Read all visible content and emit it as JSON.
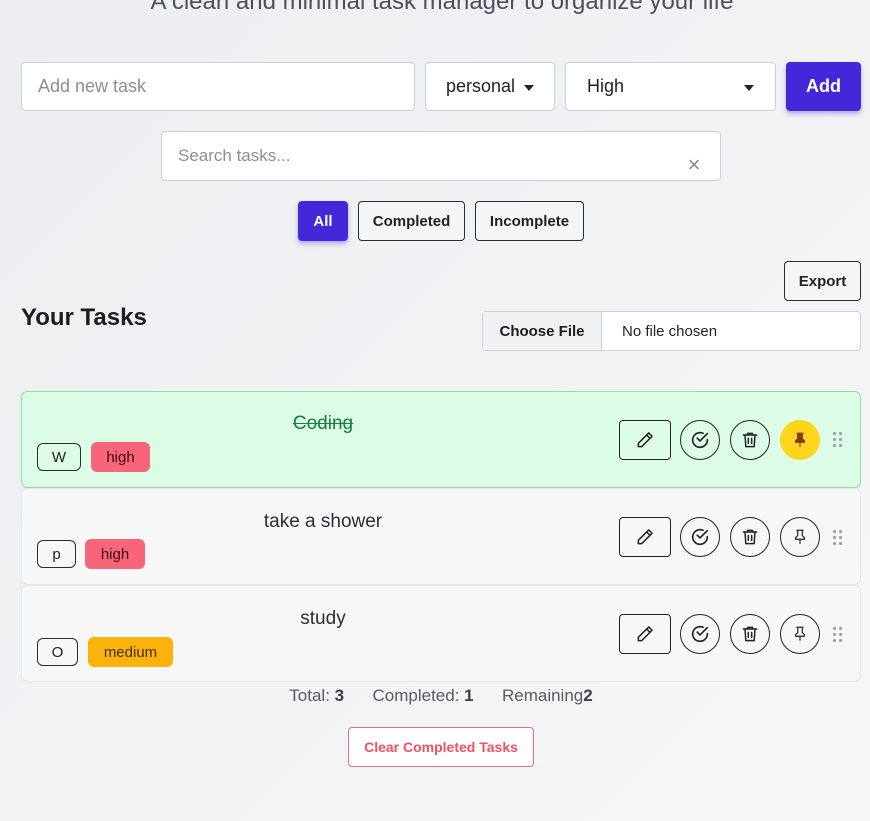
{
  "app": {
    "subtitle": "A clean and minimal task manager to organize your life"
  },
  "add_form": {
    "input_placeholder": "Add new task",
    "input_value": "",
    "category_selected": "personal",
    "priority_selected": "High",
    "add_label": "Add"
  },
  "search": {
    "placeholder": "Search tasks...",
    "value": "",
    "clear_glyph": "×"
  },
  "filters": {
    "all": "All",
    "completed": "Completed",
    "incomplete": "Incomplete",
    "active": "All"
  },
  "export_label": "Export",
  "section_title": "Your Tasks",
  "file_input": {
    "button": "Choose File",
    "status": "No file chosen"
  },
  "tasks": [
    {
      "title": "Coding",
      "category_initial": "W",
      "priority": "high",
      "completed": true,
      "pinned": true
    },
    {
      "title": "take a shower",
      "category_initial": "p",
      "priority": "high",
      "completed": false,
      "pinned": false
    },
    {
      "title": "study",
      "category_initial": "O",
      "priority": "medium",
      "completed": false,
      "pinned": false
    }
  ],
  "stats": {
    "total_label": "Total:",
    "total": "3",
    "completed_label": "Completed:",
    "completed": "1",
    "remaining_label": "Remaining",
    "remaining": "2"
  },
  "clear_completed_label": "Clear Completed Tasks",
  "colors": {
    "accent": "#4327d9",
    "done_bg": "#dcfce7",
    "high": "#f8647a",
    "medium": "#fbb30c",
    "pin": "#fcd61d",
    "danger": "#ef4f68"
  },
  "icons": [
    "chevron-down-icon",
    "close-icon",
    "pencil-icon",
    "check-circle-icon",
    "trash-icon",
    "pin-icon",
    "drag-handle-icon"
  ]
}
